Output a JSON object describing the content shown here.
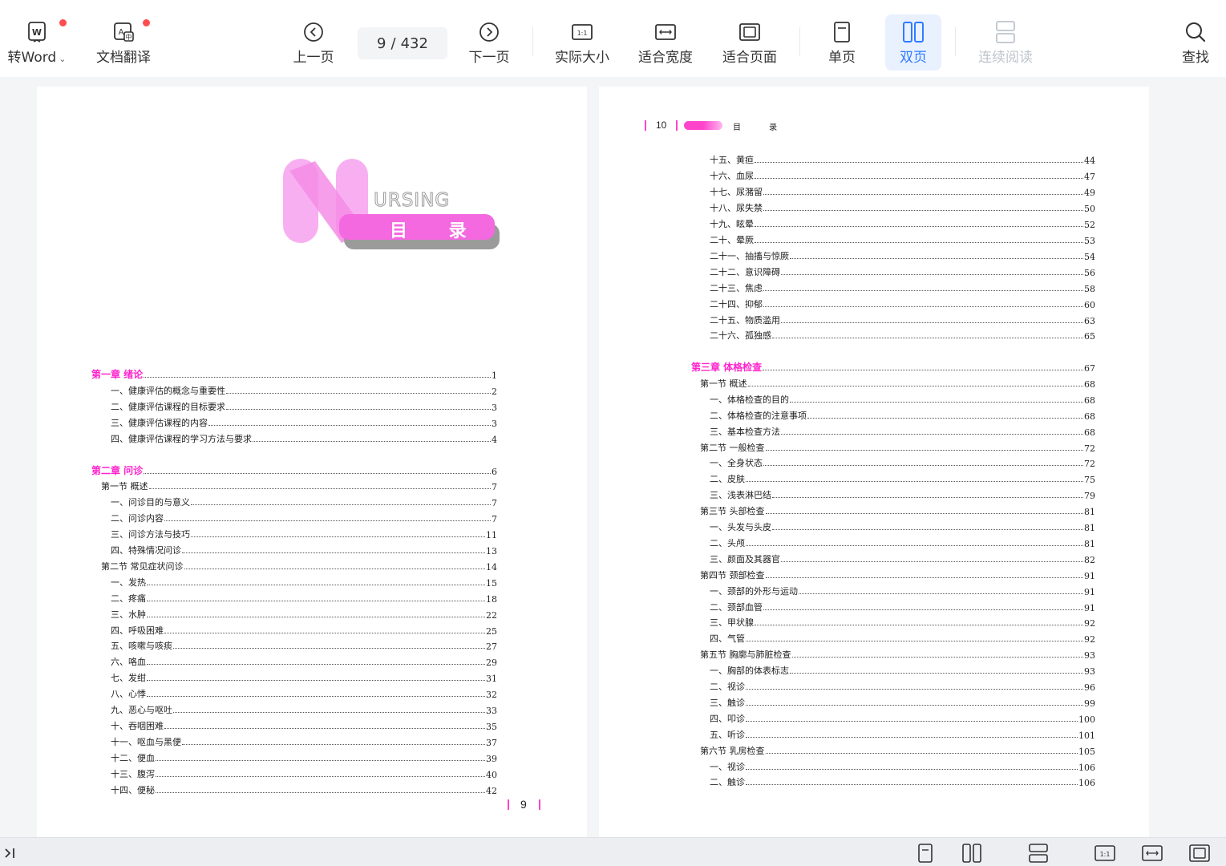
{
  "toolbar": {
    "to_word": "转Word",
    "doc_translate": "文档翻译",
    "prev_page": "上一页",
    "current_page": "9",
    "page_sep": "/",
    "total_pages": "432",
    "next_page": "下一页",
    "actual_size": "实际大小",
    "fit_width": "适合宽度",
    "fit_page": "适合页面",
    "single_page": "单页",
    "double_page": "双页",
    "continuous": "连续阅读",
    "find": "查找"
  },
  "icons": {
    "to_word": "word-doc-icon",
    "translate": "translate-doc-icon",
    "prev": "circle-chevron-left-icon",
    "next": "circle-chevron-right-icon",
    "actual": "one-to-one-icon",
    "width": "fit-width-icon",
    "page": "fit-page-icon",
    "single": "single-page-icon",
    "double": "double-page-icon",
    "continuous": "continuous-read-icon",
    "find": "search-icon",
    "collapse": "sidebar-expand-icon"
  },
  "colors": {
    "accent": "#2f7bff",
    "chapter_pink": "#ff22cc",
    "notification": "#ff4d4f"
  },
  "left_page": {
    "logo_word": "URSING",
    "logo_title": "目 录",
    "footer_number": "9",
    "toc": [
      {
        "title": "第一章   绪论",
        "page": "1",
        "level": "chapter"
      },
      {
        "title": "一、健康评估的概念与重要性",
        "page": "2",
        "level": "item"
      },
      {
        "title": "二、健康评估课程的目标要求",
        "page": "3",
        "level": "item"
      },
      {
        "title": "三、健康评估课程的内容",
        "page": "3",
        "level": "item"
      },
      {
        "title": "四、健康评估课程的学习方法与要求",
        "page": "4",
        "level": "item"
      },
      {
        "title": "第二章   问诊",
        "page": "6",
        "level": "chapter"
      },
      {
        "title": "第一节   概述",
        "page": "7",
        "level": "section"
      },
      {
        "title": "一、问诊目的与意义",
        "page": "7",
        "level": "item"
      },
      {
        "title": "二、问诊内容",
        "page": "7",
        "level": "item"
      },
      {
        "title": "三、问诊方法与技巧",
        "page": "11",
        "level": "item"
      },
      {
        "title": "四、特殊情况问诊",
        "page": "13",
        "level": "item"
      },
      {
        "title": "第二节   常见症状问诊",
        "page": "14",
        "level": "section"
      },
      {
        "title": "一、发热",
        "page": "15",
        "level": "item"
      },
      {
        "title": "二、疼痛",
        "page": "18",
        "level": "item"
      },
      {
        "title": "三、水肿",
        "page": "22",
        "level": "item"
      },
      {
        "title": "四、呼吸困难",
        "page": "25",
        "level": "item"
      },
      {
        "title": "五、咳嗽与咳痰",
        "page": "27",
        "level": "item"
      },
      {
        "title": "六、咯血",
        "page": "29",
        "level": "item"
      },
      {
        "title": "七、发绀",
        "page": "31",
        "level": "item"
      },
      {
        "title": "八、心悸",
        "page": "32",
        "level": "item"
      },
      {
        "title": "九、恶心与呕吐",
        "page": "33",
        "level": "item"
      },
      {
        "title": "十、吞咽困难",
        "page": "35",
        "level": "item"
      },
      {
        "title": "十一、呕血与黑便",
        "page": "37",
        "level": "item"
      },
      {
        "title": "十二、便血",
        "page": "39",
        "level": "item"
      },
      {
        "title": "十三、腹泻",
        "page": "40",
        "level": "item"
      },
      {
        "title": "十四、便秘",
        "page": "42",
        "level": "item"
      }
    ]
  },
  "right_page": {
    "header_number": "10",
    "header_title": "目 录",
    "toc_a": [
      {
        "title": "十五、黄疸",
        "page": "44",
        "level": "item"
      },
      {
        "title": "十六、血尿",
        "page": "47",
        "level": "item"
      },
      {
        "title": "十七、尿潴留",
        "page": "49",
        "level": "item"
      },
      {
        "title": "十八、尿失禁",
        "page": "50",
        "level": "item"
      },
      {
        "title": "十九、眩晕",
        "page": "52",
        "level": "item"
      },
      {
        "title": "二十、晕厥",
        "page": "53",
        "level": "item"
      },
      {
        "title": "二十一、抽搐与惊厥",
        "page": "54",
        "level": "item"
      },
      {
        "title": "二十二、意识障碍",
        "page": "56",
        "level": "item"
      },
      {
        "title": "二十三、焦虑",
        "page": "58",
        "level": "item"
      },
      {
        "title": "二十四、抑郁",
        "page": "60",
        "level": "item"
      },
      {
        "title": "二十五、物质滥用",
        "page": "63",
        "level": "item"
      },
      {
        "title": "二十六、孤独感",
        "page": "65",
        "level": "item"
      }
    ],
    "toc_b": [
      {
        "title": "第三章   体格检查",
        "page": "67",
        "level": "chapter"
      },
      {
        "title": "第一节   概述",
        "page": "68",
        "level": "section"
      },
      {
        "title": "一、体格检查的目的",
        "page": "68",
        "level": "item"
      },
      {
        "title": "二、体格检查的注意事项",
        "page": "68",
        "level": "item"
      },
      {
        "title": "三、基本检查方法",
        "page": "68",
        "level": "item"
      },
      {
        "title": "第二节   一般检查",
        "page": "72",
        "level": "section"
      },
      {
        "title": "一、全身状态",
        "page": "72",
        "level": "item"
      },
      {
        "title": "二、皮肤",
        "page": "75",
        "level": "item"
      },
      {
        "title": "三、浅表淋巴结",
        "page": "79",
        "level": "item"
      },
      {
        "title": "第三节   头部检查",
        "page": "81",
        "level": "section"
      },
      {
        "title": "一、头发与头皮",
        "page": "81",
        "level": "item"
      },
      {
        "title": "二、头颅",
        "page": "81",
        "level": "item"
      },
      {
        "title": "三、颜面及其器官",
        "page": "82",
        "level": "item"
      },
      {
        "title": "第四节   颈部检查",
        "page": "91",
        "level": "section"
      },
      {
        "title": "一、颈部的外形与运动",
        "page": "91",
        "level": "item"
      },
      {
        "title": "二、颈部血管",
        "page": "91",
        "level": "item"
      },
      {
        "title": "三、甲状腺",
        "page": "92",
        "level": "item"
      },
      {
        "title": "四、气管",
        "page": "92",
        "level": "item"
      },
      {
        "title": "第五节   胸廓与肺脏检查",
        "page": "93",
        "level": "section"
      },
      {
        "title": "一、胸部的体表标志",
        "page": "93",
        "level": "item"
      },
      {
        "title": "二、视诊",
        "page": "96",
        "level": "item"
      },
      {
        "title": "三、触诊",
        "page": "99",
        "level": "item"
      },
      {
        "title": "四、叩诊",
        "page": "100",
        "level": "item"
      },
      {
        "title": "五、听诊",
        "page": "101",
        "level": "item"
      },
      {
        "title": "第六节   乳房检查",
        "page": "105",
        "level": "section"
      },
      {
        "title": "一、视诊",
        "page": "106",
        "level": "item"
      },
      {
        "title": "二、触诊",
        "page": "106",
        "level": "item"
      }
    ]
  }
}
